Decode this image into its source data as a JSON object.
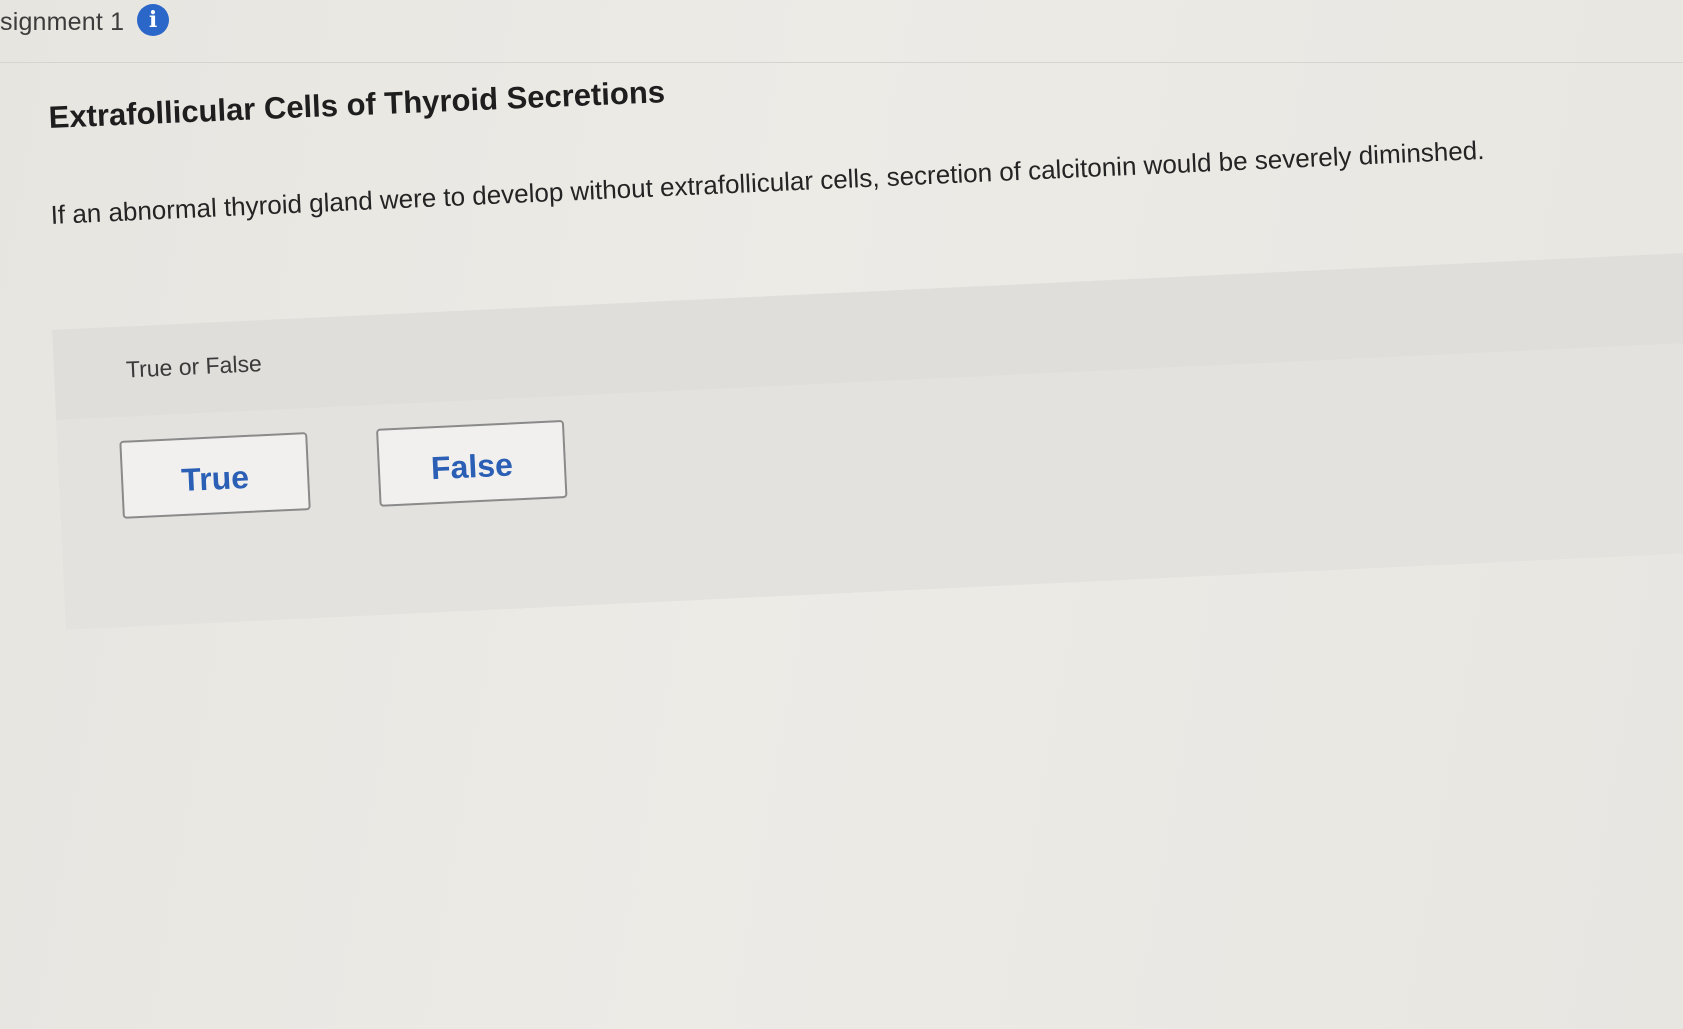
{
  "header": {
    "assignment_title": "signment 1",
    "info_icon": "info-icon"
  },
  "question": {
    "title": "Extrafollicular Cells of Thyroid Secretions",
    "text": "If an abnormal thyroid gland were to develop without extrafollicular cells, secretion of calcitonin would be severely diminshed."
  },
  "answer": {
    "prompt_label": "True or False",
    "options": [
      {
        "label": "True"
      },
      {
        "label": "False"
      }
    ]
  },
  "colors": {
    "accent": "#2a5fb5",
    "info_icon_bg": "#2a67c8",
    "panel_bg": "#e0dedb"
  }
}
